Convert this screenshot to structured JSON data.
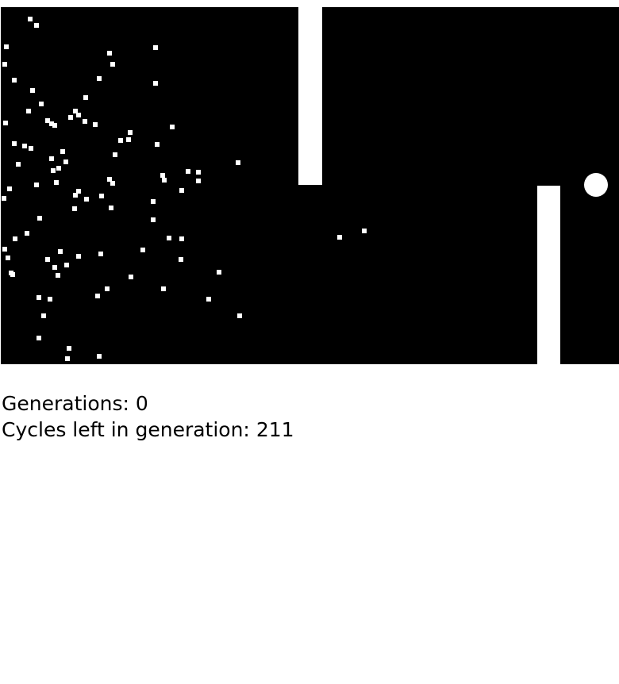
{
  "game": {
    "background_color": "#000000",
    "wall_color": "#ffffff",
    "dot_color": "#ffffff",
    "goal_color": "#ffffff"
  },
  "stats": {
    "generations_label": "Generations:",
    "generations_value": "0",
    "cycles_label": "Cycles left in generation:",
    "cycles_value": "211"
  }
}
